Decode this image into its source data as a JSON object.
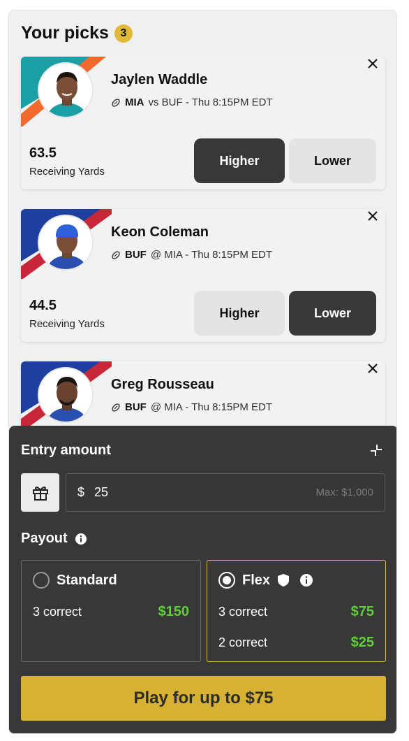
{
  "header": {
    "title": "Your picks",
    "count": "3"
  },
  "picks": [
    {
      "name": "Jaylen Waddle",
      "team": "MIA",
      "matchup": "vs BUF - Thu 8:15PM EDT",
      "stat_value": "63.5",
      "stat_label": "Receiving Yards",
      "higher_label": "Higher",
      "lower_label": "Lower",
      "selected": "Higher",
      "colors": {
        "primary": "#1a9fa5",
        "stripe": "#f26a2e"
      }
    },
    {
      "name": "Keon Coleman",
      "team": "BUF",
      "matchup": "@ MIA - Thu 8:15PM EDT",
      "stat_value": "44.5",
      "stat_label": "Receiving Yards",
      "higher_label": "Higher",
      "lower_label": "Lower",
      "selected": "Lower",
      "colors": {
        "primary": "#1f3fa0",
        "stripe": "#c8273a"
      }
    },
    {
      "name": "Greg Rousseau",
      "team": "BUF",
      "matchup": "@ MIA - Thu 8:15PM EDT",
      "colors": {
        "primary": "#1f3fa0",
        "stripe": "#c8273a"
      }
    }
  ],
  "entry": {
    "title": "Entry amount",
    "currency": "$",
    "amount": "25",
    "max_label": "Max: $1,000",
    "payout_label": "Payout",
    "options": {
      "standard": {
        "label": "Standard",
        "selected": false,
        "rows": [
          {
            "label": "3 correct",
            "amount": "$150"
          }
        ]
      },
      "flex": {
        "label": "Flex",
        "selected": true,
        "rows": [
          {
            "label": "3 correct",
            "amount": "$75"
          },
          {
            "label": "2 correct",
            "amount": "$25"
          }
        ]
      }
    },
    "play_label": "Play for up to $75"
  },
  "icons": {
    "close": "close-icon",
    "football": "football-icon",
    "gift": "gift-icon",
    "collapse": "collapse-icon",
    "info": "info-icon",
    "shield": "shield-icon"
  },
  "colors": {
    "accent": "#d7b132",
    "payout_green": "#5fcf3a",
    "dark_panel": "#383838"
  }
}
